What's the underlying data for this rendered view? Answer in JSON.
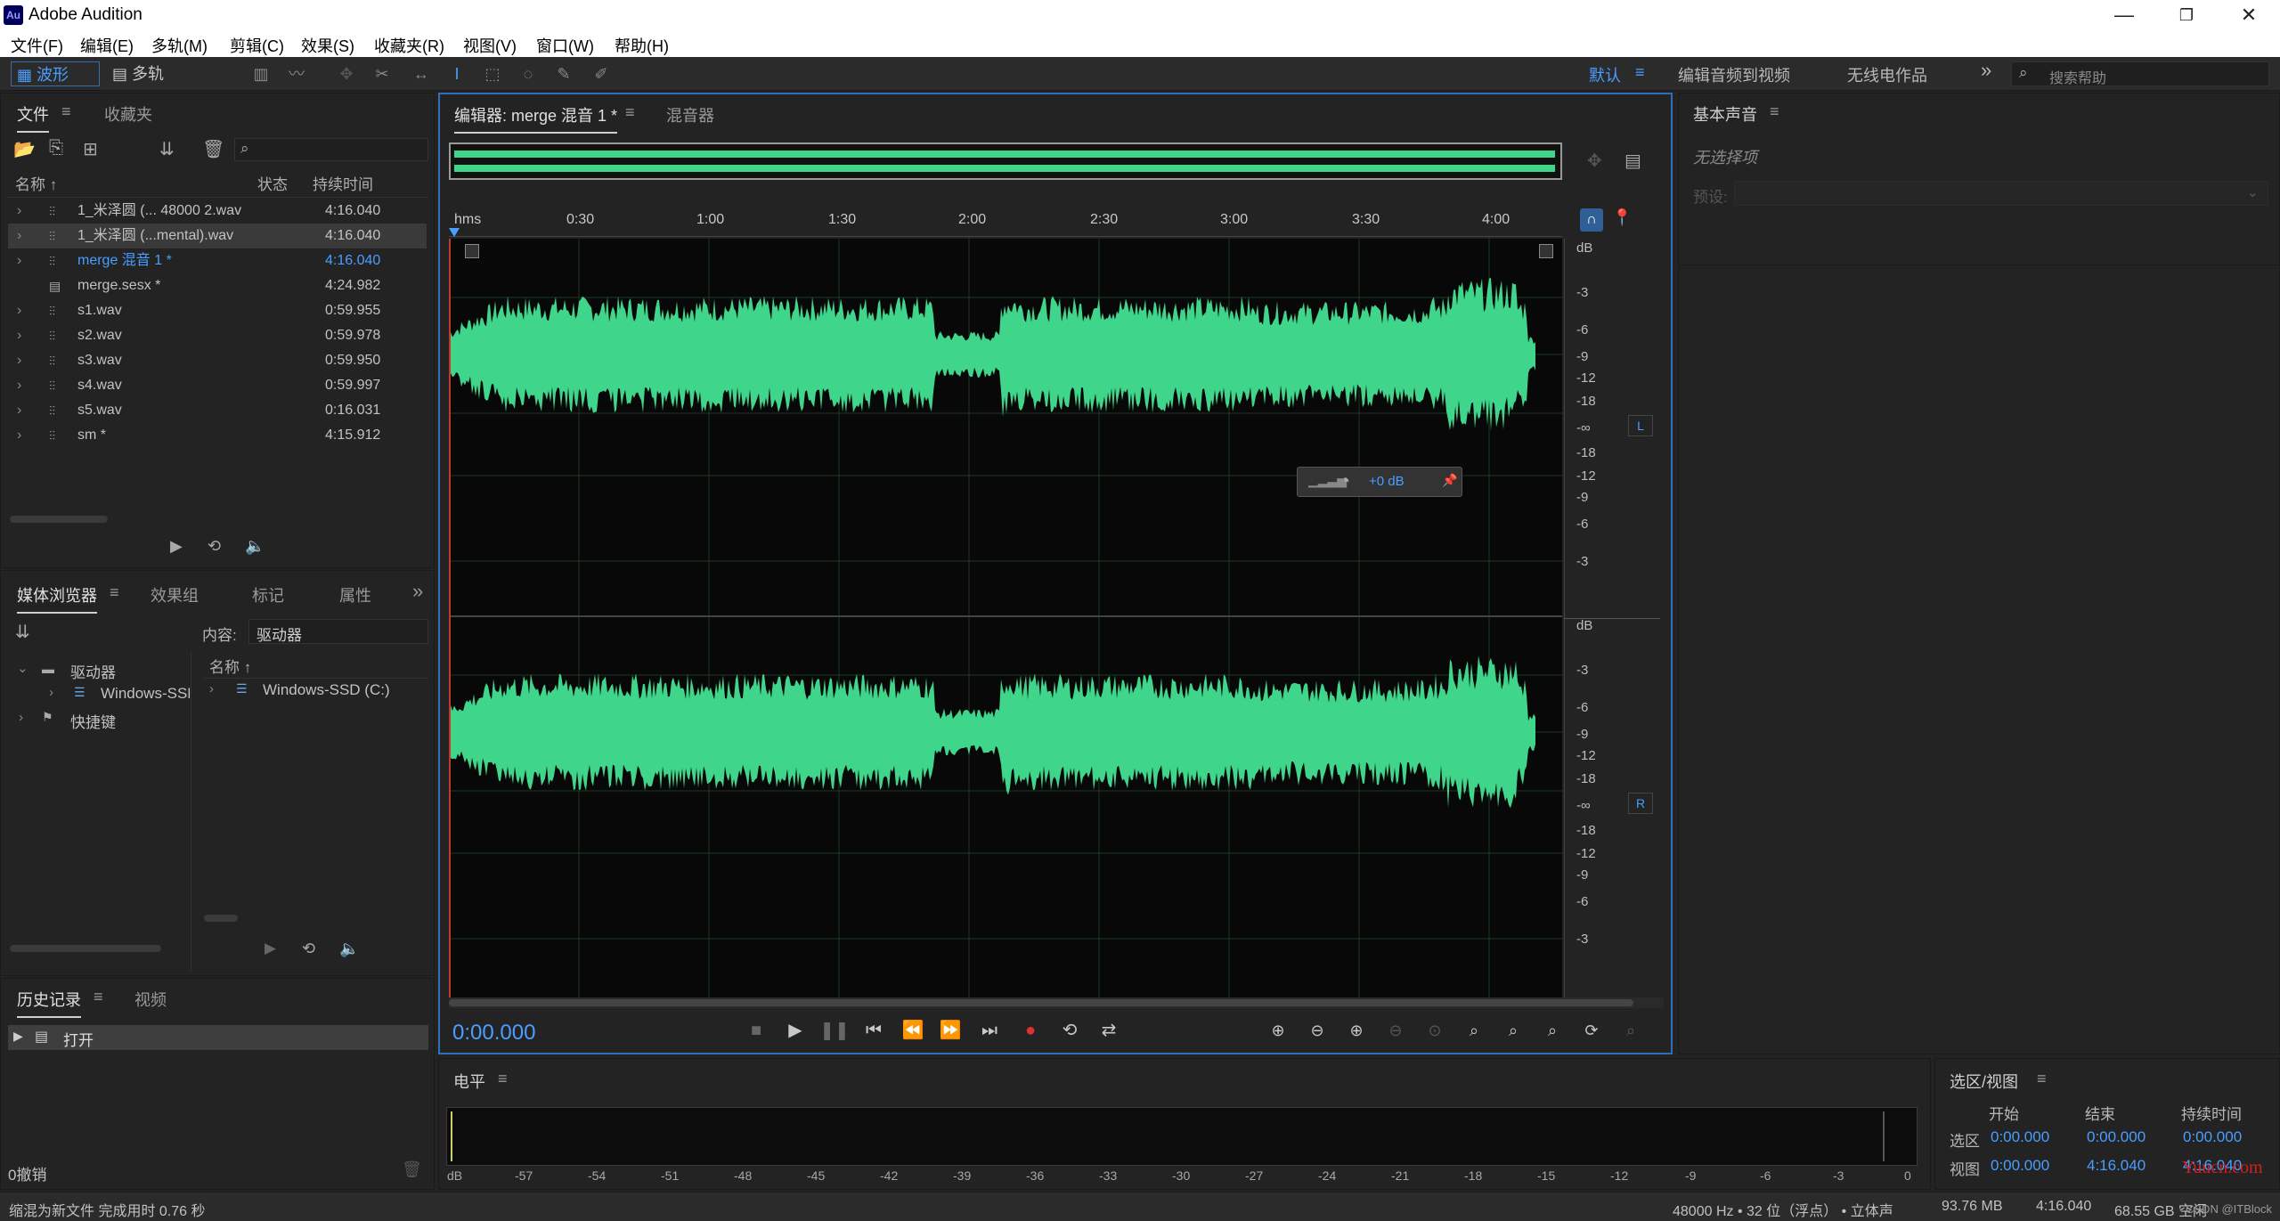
{
  "app": {
    "title": "Adobe Audition",
    "logo": "Au"
  },
  "window": {
    "min": "—",
    "max": "❐",
    "close": "✕"
  },
  "menu": [
    "文件(F)",
    "编辑(E)",
    "多轨(M)",
    "剪辑(C)",
    "效果(S)",
    "收藏夹(R)",
    "视图(V)",
    "窗口(W)",
    "帮助(H)"
  ],
  "toolbar": {
    "waveform": "波形",
    "multitrack": "多轨"
  },
  "workspaces": {
    "default": "默认",
    "edit_video": "编辑音频到视频",
    "radio": "无线电作品",
    "more": "»",
    "search_placeholder": "搜索帮助"
  },
  "files_panel": {
    "tabs": [
      "文件",
      "收藏夹"
    ],
    "columns": {
      "name": "名称 ↑",
      "status": "状态",
      "duration": "持续时间"
    },
    "rows": [
      {
        "name": "1_米泽圆 (... 48000 2.wav",
        "duration": "4:16.040"
      },
      {
        "name": "1_米泽圆 (...mental).wav",
        "duration": "4:16.040"
      },
      {
        "name": "merge 混音 1 *",
        "duration": "4:16.040"
      },
      {
        "name": "merge.sesx *",
        "duration": "4:24.982"
      },
      {
        "name": "s1.wav",
        "duration": "0:59.955"
      },
      {
        "name": "s2.wav",
        "duration": "0:59.978"
      },
      {
        "name": "s3.wav",
        "duration": "0:59.950"
      },
      {
        "name": "s4.wav",
        "duration": "0:59.997"
      },
      {
        "name": "s5.wav",
        "duration": "0:16.031"
      },
      {
        "name": "sm *",
        "duration": "4:15.912"
      }
    ]
  },
  "media_panel": {
    "tabs": [
      "媒体浏览器",
      "效果组",
      "标记",
      "属性"
    ],
    "content_label": "内容:",
    "content_value": "驱动器",
    "tree": [
      "驱动器",
      "Windows-SSD",
      "快捷键"
    ],
    "list_header": "名称 ↑",
    "list_item": "Windows-SSD (C:)"
  },
  "history_panel": {
    "tabs": [
      "历史记录",
      "视频"
    ],
    "item": "打开",
    "undo": "0撤销"
  },
  "editor": {
    "tab": "编辑器: merge 混音 1 *",
    "mixer_tab": "混音器",
    "ruler": {
      "unit": "hms",
      "ticks": [
        "0:30",
        "1:00",
        "1:30",
        "2:00",
        "2:30",
        "3:00",
        "3:30",
        "4:00"
      ]
    },
    "db_scale_top": [
      "dB",
      "-3",
      "-6",
      "-9",
      "-12",
      "-18",
      "-∞",
      "-18",
      "-12",
      "-9",
      "-6",
      "-3"
    ],
    "db_scale_bottom": [
      "dB",
      "-3",
      "-6",
      "-9",
      "-12",
      "-18",
      "-∞",
      "-18",
      "-12",
      "-9",
      "-6",
      "-3"
    ],
    "channel_left": "L",
    "channel_right": "R",
    "hud_gain": "+0 dB",
    "time": "0:00.000",
    "waveform_color": "#3fd68b"
  },
  "essential_sound": {
    "title": "基本声音",
    "no_selection": "无选择项",
    "preset_label": "预设:"
  },
  "levels": {
    "title": "电平",
    "scale": [
      "dB",
      "-57",
      "-54",
      "-51",
      "-48",
      "-45",
      "-42",
      "-39",
      "-36",
      "-33",
      "-30",
      "-27",
      "-24",
      "-21",
      "-18",
      "-15",
      "-12",
      "-9",
      "-6",
      "-3",
      "0"
    ]
  },
  "selection_view": {
    "title": "选区/视图",
    "headers": [
      "开始",
      "结束",
      "持续时间"
    ],
    "selection_label": "选区",
    "view_label": "视图",
    "selection": [
      "0:00.000",
      "0:00.000",
      "0:00.000"
    ],
    "view": [
      "0:00.000",
      "4:16.040",
      "4:16.040"
    ]
  },
  "statusbar": {
    "message": "缩混为新文件 完成用时 0.76 秒",
    "format": "48000 Hz • 32 位（浮点） • 立体声",
    "size": "93.76 MB",
    "duration": "4:16.040",
    "free": "68.55 GB 空闲",
    "watermark": "Yuucn.com",
    "credit": "CSDN @ITBlock"
  }
}
